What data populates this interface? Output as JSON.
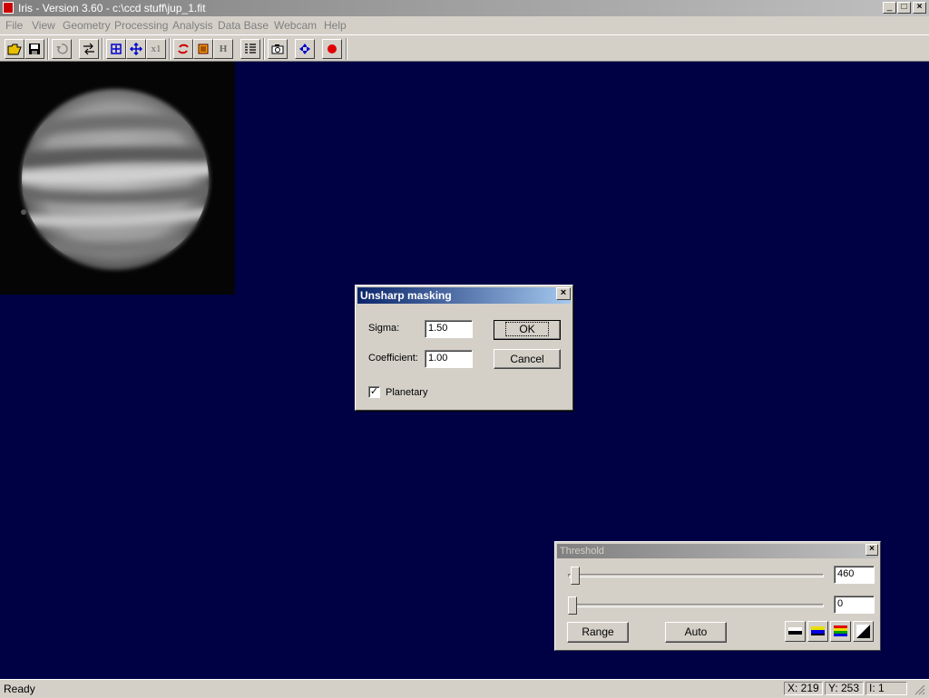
{
  "window": {
    "title": "Iris - Version 3.60 - c:\\ccd stuff\\jup_1.fit",
    "min_glyph": "_",
    "max_glyph": "□",
    "close_glyph": "×"
  },
  "menu": [
    "File",
    "View",
    "Geometry",
    "Processing",
    "Analysis",
    "Data Base",
    "Webcam",
    "Help"
  ],
  "toolbar_text": {
    "x1": "x1",
    "h": "H"
  },
  "dialog": {
    "title": "Unsharp masking",
    "sigma_label": "Sigma:",
    "sigma_value": "1.50",
    "coef_label": "Coefficient:",
    "coef_value": "1.00",
    "ok_label": "OK",
    "cancel_label": "Cancel",
    "planetary_label": "Planetary",
    "planetary_checked": true,
    "close_glyph": "×",
    "check_glyph": "✓"
  },
  "threshold": {
    "title": "Threshold",
    "high_value": "460",
    "low_value": "0",
    "range_label": "Range",
    "auto_label": "Auto",
    "close_glyph": "×"
  },
  "status": {
    "text": "Ready",
    "x": "X: 219",
    "y": "Y: 253",
    "i": "I: 1"
  },
  "colors": {
    "workspace": "#000044",
    "accent": "#0a246a"
  }
}
